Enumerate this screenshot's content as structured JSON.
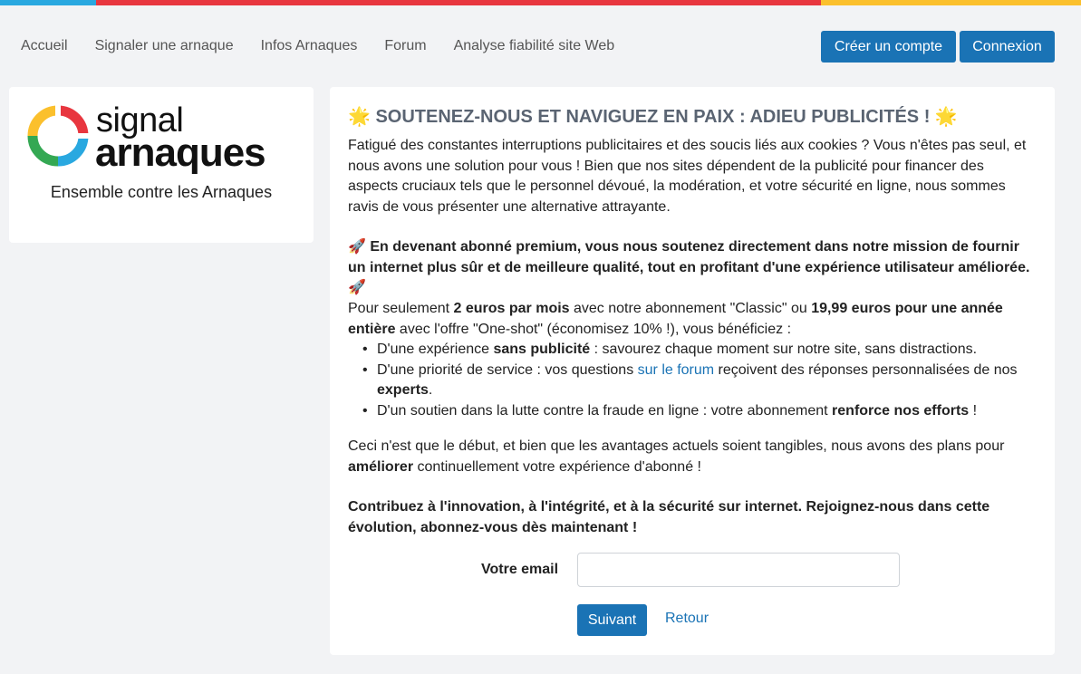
{
  "colors": {
    "topbar": [
      "#29a8e0",
      "#e8363f",
      "#fbc02d"
    ],
    "accent": "#1a73b5",
    "background": "#f2f3f5"
  },
  "nav": {
    "links": [
      "Accueil",
      "Signaler une arnaque",
      "Infos Arnaques",
      "Forum",
      "Analyse fiabilité site Web"
    ],
    "create_account": "Créer un compte",
    "login": "Connexion"
  },
  "logo": {
    "line1": "signal",
    "line2": "arnaques",
    "tagline": "Ensemble contre les Arnaques"
  },
  "content": {
    "title_icon": "🌟",
    "title": "SOUTENEZ-NOUS ET NAVIGUEZ EN PAIX : ADIEU PUBLICITÉS !",
    "intro": "Fatigué des constantes interruptions publicitaires et des soucis liés aux cookies ? Vous n'êtes pas seul, et nous avons une solution pour vous ! Bien que nos sites dépendent de la publicité pour financer des aspects cruciaux tels que le personnel dévoué, la modération, et votre sécurité en ligne, nous sommes ravis de vous présenter une alternative attrayante.",
    "rocket_icon": "🚀",
    "premium": "En devenant abonné premium, vous nous soutenez directement dans notre mission de fournir un internet plus sûr et de meilleure qualité, tout en profitant d'une expérience utilisateur améliorée.",
    "price_a": "Pour seulement ",
    "price_b": "2 euros par mois",
    "price_c": " avec notre abonnement \"Classic\" ou ",
    "price_d": "19,99 euros pour une année entière",
    "price_e": " avec l'offre \"One-shot\" (économisez 10% !), vous bénéficiez :",
    "b1_a": "D'une expérience ",
    "b1_b": "sans publicité",
    "b1_c": " : savourez chaque moment sur notre site, sans distractions.",
    "b2_a": "D'une priorité de service : vos questions ",
    "b2_link": "sur le forum",
    "b2_c": " reçoivent des réponses personnalisées de nos ",
    "b2_d": "experts",
    "b2_e": ".",
    "b3_a": "D'un soutien dans la lutte contre la fraude en ligne : votre abonnement ",
    "b3_b": "renforce nos efforts",
    "b3_c": " !",
    "more_a": "Ceci n'est que le début, et bien que les avantages actuels soient tangibles, nous avons des plans pour ",
    "more_b": "améliorer",
    "more_c": " continuellement votre expérience d'abonné !",
    "cta": "Contribuez à l'innovation, à l'intégrité, et à la sécurité sur internet. Rejoignez-nous dans cette évolution, abonnez-vous dès maintenant !"
  },
  "form": {
    "email_label": "Votre email",
    "email_value": "",
    "next": "Suivant",
    "back": "Retour"
  }
}
